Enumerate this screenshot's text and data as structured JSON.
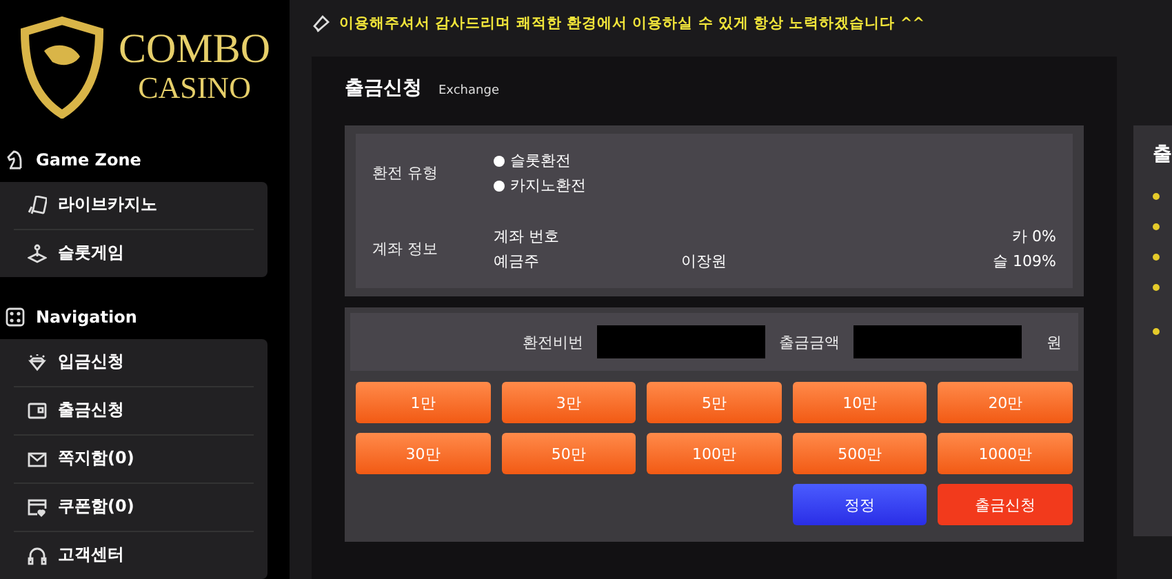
{
  "logo": {
    "line_1": "COMBO",
    "line_2": "CASINO"
  },
  "sidebar": {
    "sections": [
      {
        "title": "Game Zone",
        "kind": "knight",
        "items": [
          {
            "label": "라이브카지노",
            "kind": "cards"
          },
          {
            "label": "슬롯게임",
            "kind": "joystick"
          }
        ]
      },
      {
        "title": "Navigation",
        "kind": "dice",
        "items": [
          {
            "label": "입금신청",
            "kind": "diamond"
          },
          {
            "label": "출금신청",
            "kind": "wallet"
          },
          {
            "label": "쪽지함(0)",
            "kind": "mail"
          },
          {
            "label": "쿠폰함(0)",
            "kind": "coupon"
          },
          {
            "label": "고객센터",
            "kind": "headset"
          }
        ]
      }
    ]
  },
  "notice": "이용해주셔서 감사드리며 쾌적한 환경에서 이용하실 수 있게 항상 노력하겠습니다 ^^",
  "page": {
    "title": "출금신청",
    "subtitle": "Exchange"
  },
  "exchange_type": {
    "label": "환전 유형",
    "options": [
      {
        "label": "슬롯환전",
        "selected": false
      },
      {
        "label": "카지노환전",
        "selected": false
      }
    ]
  },
  "account": {
    "label": "계좌 정보",
    "number_label": "계좌 번호",
    "holder_label": "예금주",
    "holder": "이장원",
    "rate_1": "카 0%",
    "rate_2": "슬 109%"
  },
  "fields": {
    "password_label": "환전비번",
    "amount_label": "출금금액",
    "unit": "원"
  },
  "amounts": [
    "1만",
    "3만",
    "5만",
    "10만",
    "20만",
    "30만",
    "50만",
    "100만",
    "500만",
    "1000만"
  ],
  "actions": [
    {
      "label": "정정",
      "kind": "reset"
    },
    {
      "label": "출금신청",
      "kind": "submit"
    }
  ],
  "side_panel": {
    "title": "출"
  }
}
